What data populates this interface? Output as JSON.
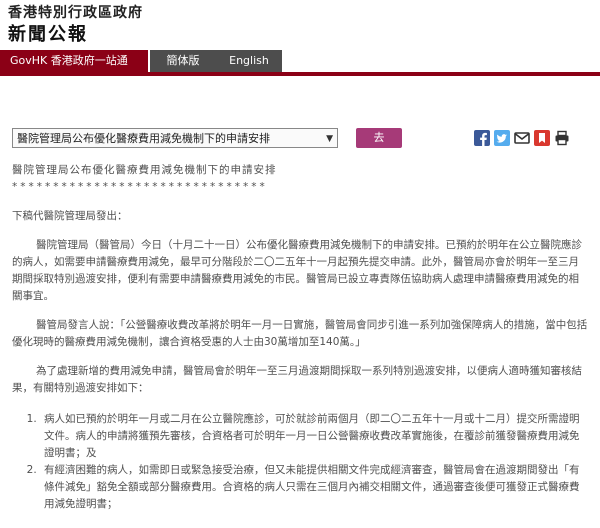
{
  "header": {
    "title_line1": "香港特別行政區政府",
    "title_line2": "新聞公報"
  },
  "nav": {
    "govhk": "GovHK 香港政府一站通",
    "simplified": "簡体版",
    "english": "English"
  },
  "toolbar": {
    "select_value": "醫院管理局公布優化醫療費用減免機制下的申請安排",
    "go_label": "去",
    "share_icons": [
      "facebook-icon",
      "twitter-icon",
      "email-icon",
      "bookmark-icon",
      "print-icon"
    ],
    "colors": {
      "facebook": "#3b5998",
      "twitter": "#55acee",
      "email": "#333333",
      "bookmark": "#d9382f",
      "print": "#333333"
    }
  },
  "article": {
    "headline": "醫院管理局公布優化醫療費用減免機制下的申請安排",
    "stars": "*******************************",
    "byline": "下稿代醫院管理局發出：",
    "paragraphs": [
      "醫院管理局（醫管局）今日（十月二十一日）公布優化醫療費用減免機制下的申請安排。已預約於明年在公立醫院應診的病人，如需要申請醫療費用減免，最早可分階段於二〇二五年十一月起預先提交申請。此外，醫管局亦會於明年一至三月期間採取特別過渡安排，便利有需要申請醫療費用減免的市民。醫管局已設立專責隊伍協助病人處理申請醫療費用減免的相關事宜。",
      "醫管局發言人說：「公營醫療收費改革將於明年一月一日實施，醫管局會同步引進一系列加強保障病人的措施，當中包括優化現時的醫療費用減免機制，讓合資格受惠的人士由30萬增加至140萬。」",
      "為了處理新增的費用減免申請，醫管局會於明年一至三月過渡期間採取一系列特別過渡安排，以便病人適時獲知審核結果，有關特別過渡安排如下："
    ],
    "list_items": [
      "病人如已預約於明年一月或二月在公立醫院應診，可於就診前兩個月（即二〇二五年十一月或十二月）提交所需證明文件。病人的申請將獲預先審核，合資格者可於明年一月一日公營醫療收費改革實施後，在覆診前獲發醫療費用減免證明書；及",
      "有經濟困難的病人，如需即日或緊急接受治療，但又未能提供相關文件完成經濟審查，醫管局會在過渡期間發出「有條件減免」豁免全額或部分醫療費用。合資格的病人只需在三個月內補交相關文件，通過審查後便可獲發正式醫療費用減免證明書；"
    ]
  }
}
